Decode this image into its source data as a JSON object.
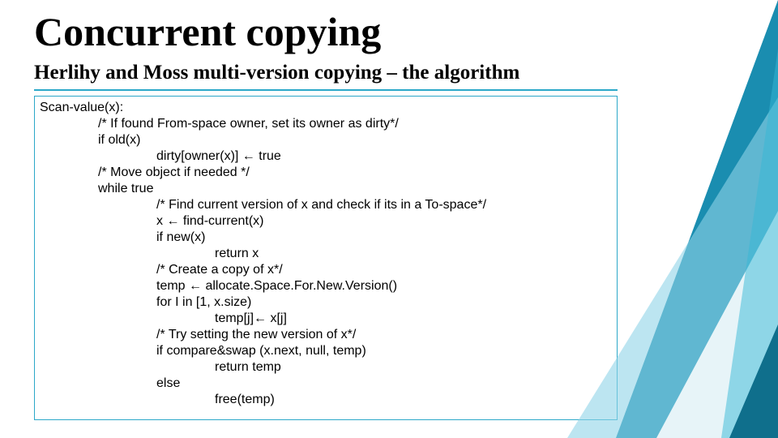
{
  "title": "Concurrent copying",
  "subtitle": "Herlihy and Moss multi-version copying – the algorithm",
  "code": {
    "l0": "Scan-value(x):",
    "l1": "/* If found From-space owner, set its owner as dirty*/",
    "l2": "if old(x)",
    "l3": "dirty[owner(x)] ← true",
    "l4": "/* Move object if needed */",
    "l5": "while true",
    "l6": "/* Find current version of x and check if its in a To-space*/",
    "l7": "x ← find-current(x)",
    "l8": "if new(x)",
    "l9": "return x",
    "l10": "/* Create  a copy of x*/",
    "l11": "temp ← allocate.Space.For.New.Version()",
    "l12": "for I in [1, x.size)",
    "l13": "temp[j]← x[j]",
    "l14": "/* Try setting the new version of x*/",
    "l15": "if compare&swap (x.next, null, temp)",
    "l16": "return temp",
    "l17": "else",
    "l18": "free(temp)"
  }
}
